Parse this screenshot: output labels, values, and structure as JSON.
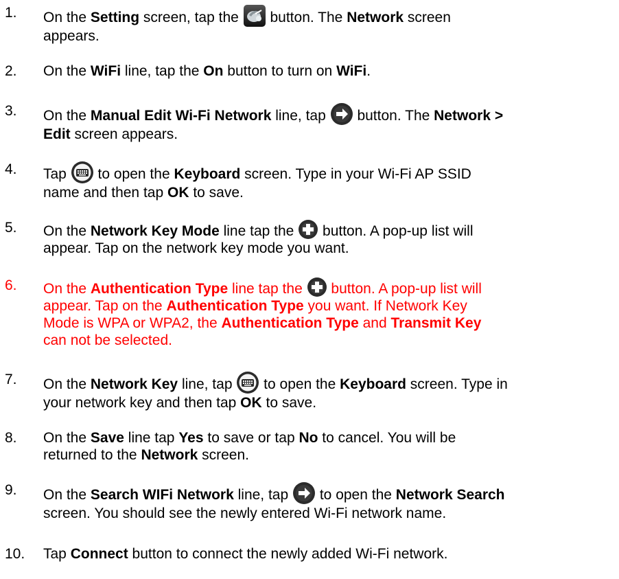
{
  "steps": [
    {
      "num": "1.",
      "l1a": "On the ",
      "l1b": "Setting",
      "l1c": " screen, tap the ",
      "l1d": " button.  The ",
      "l1e": "Network",
      "l1f": " screen",
      "l2": "appears.",
      "icon": "network-settings-icon"
    },
    {
      "num": "2.",
      "a": "On the ",
      "b": "WiFi",
      "c": " line, tap the ",
      "d": "On",
      "e": " button to turn on ",
      "f": "WiFi",
      "g": "."
    },
    {
      "num": "3.",
      "a": "On the ",
      "b": "Manual Edit Wi-Fi Network",
      "c": " line, tap ",
      "d": " button.  The ",
      "e": "Network >",
      "f": "Edit",
      "g": " screen appears.",
      "icon": "arrow-right-icon"
    },
    {
      "num": "4.",
      "a": "Tap ",
      "b": " to open the ",
      "c": "Keyboard",
      "d": " screen.  Type in your Wi-Fi AP SSID",
      "e": "name and then tap ",
      "f": "OK",
      "g": " to save.",
      "icon": "keyboard-icon"
    },
    {
      "num": "5.",
      "a": "On the ",
      "b": "Network Key Mode",
      "c": " line tap the ",
      "d": " button.  A pop-up list will",
      "e": "appear.  Tap on the network key mode you want.",
      "icon": "plus-icon"
    },
    {
      "num": "6.",
      "a": "On the ",
      "b": "Authentication Type",
      "c": " line tap the ",
      "d": " button.  A pop-up list will",
      "e": "appear.  Tap on the ",
      "f": "Authentication Type",
      "g": " you want. If Network Key",
      "h": "Mode is WPA or WPA2, the ",
      "i": "Authentication Type",
      "j": " and ",
      "k": "Transmit Key",
      "l": "can not be selected.",
      "icon": "plus-icon",
      "color": "#ff0000"
    },
    {
      "num": "7.",
      "a": "On the ",
      "b": "Network Key",
      "c": " line, tap ",
      "d": " to open the ",
      "e": "Keyboard",
      "f": " screen.  Type in",
      "g": "your network key and then tap ",
      "h": "OK",
      "i": " to save.",
      "icon": "keyboard-icon"
    },
    {
      "num": "8.",
      "a": "On the ",
      "b": "Save",
      "c": " line tap ",
      "d": "Yes",
      "e": " to save or tap ",
      "f": "No",
      "g": " to cancel.  You will be",
      "h": "returned to the ",
      "i": "Network",
      "j": " screen."
    },
    {
      "num": "9.",
      "a": "On the ",
      "b": "Search WIFi Network",
      "c": " line, tap ",
      "d": " to open the ",
      "e": "Network Search",
      "f": "screen.  You should see the newly entered Wi-Fi network name.",
      "icon": "arrow-right-icon"
    },
    {
      "num": "10.",
      "a": "Tap ",
      "b": "Connect",
      "c": " button to connect the newly added Wi-Fi network."
    }
  ]
}
